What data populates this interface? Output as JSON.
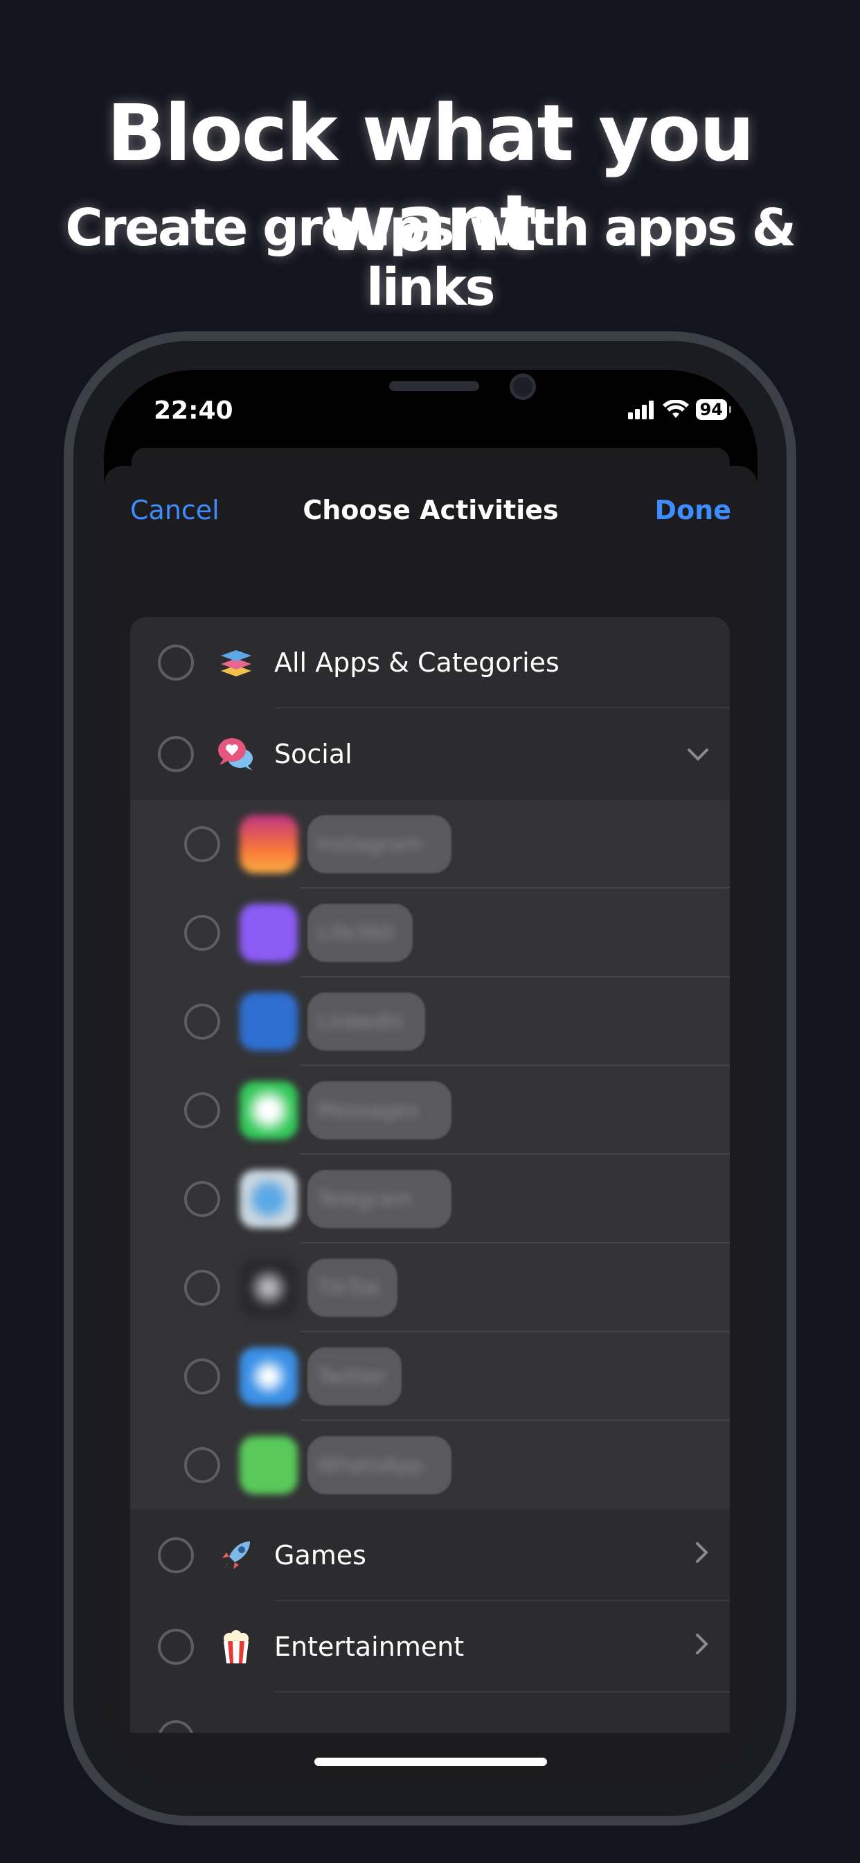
{
  "promo": {
    "headline": "Block what you want",
    "subheadline": "Create groups with apps & links"
  },
  "status_bar": {
    "time": "22:40",
    "battery": "94",
    "icons": [
      "signal-bars-icon",
      "wifi-icon",
      "battery-icon"
    ]
  },
  "nav": {
    "cancel": "Cancel",
    "title": "Choose Activities",
    "done": "Done"
  },
  "categories": {
    "all": {
      "label": "All Apps & Categories",
      "icon": "stack-layers-icon",
      "glyph": "📚"
    },
    "social": {
      "label": "Social",
      "icon": "chat-bubbles-heart-icon",
      "glyph": "💬"
    },
    "games": {
      "label": "Games",
      "icon": "rocket-icon",
      "glyph": "🚀"
    },
    "entertainment": {
      "label": "Entertainment",
      "icon": "popcorn-icon",
      "glyph": "🍿"
    }
  },
  "social_apps": [
    {
      "name": "Instagram",
      "icon": "instagram-icon",
      "color": "#e1306c"
    },
    {
      "name": "Life360",
      "icon": "life360-icon",
      "color": "#8b5cf6"
    },
    {
      "name": "LinkedIn",
      "icon": "linkedin-icon",
      "color": "#2f6fd1"
    },
    {
      "name": "Messages",
      "icon": "messages-icon",
      "color": "#34c759"
    },
    {
      "name": "Telegram",
      "icon": "telegram-icon",
      "color": "#8fb8df"
    },
    {
      "name": "TikTok",
      "icon": "tiktok-icon",
      "color": "#2a2a2e"
    },
    {
      "name": "Twitter",
      "icon": "twitter-icon",
      "color": "#3a8fe6"
    },
    {
      "name": "WhatsApp",
      "icon": "whatsapp-icon",
      "color": "#59c95a"
    }
  ],
  "colors": {
    "accent": "#3f8cff",
    "background": "#14141e",
    "sheet": "#1c1c1e",
    "list": "#2c2c2e"
  }
}
